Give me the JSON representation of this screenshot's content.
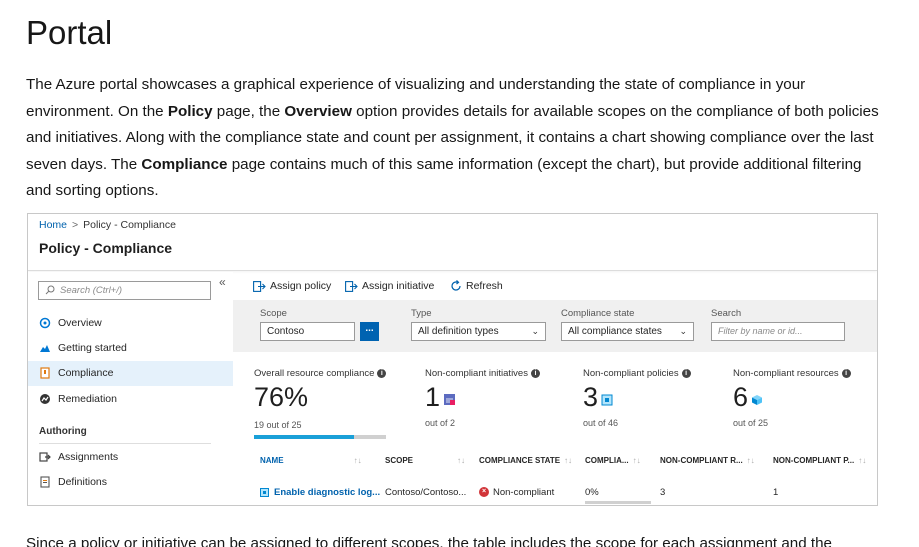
{
  "doc": {
    "title": "Portal",
    "intro_parts": [
      "The Azure portal showcases a graphical experience of visualizing and understanding the state of compliance in your environment. On the ",
      "Policy",
      " page, the ",
      "Overview",
      " option provides details for available scopes on the compliance of both policies and initiatives. Along with the compliance state and count per assignment, it contains a chart showing compliance over the last seven days. The ",
      "Compliance",
      " page contains much of this same information (except the chart), but provide additional filtering and sorting options."
    ],
    "bottom_text": "Since a policy or initiative can be assigned to different scopes, the table includes the scope for each assignment and the"
  },
  "screenshot": {
    "breadcrumb": {
      "home": "Home",
      "separator": ">",
      "current": "Policy - Compliance"
    },
    "blade_title": "Policy - Compliance",
    "collapse_glyph": "«",
    "nav": {
      "search_placeholder": "Search (Ctrl+/)",
      "items": [
        {
          "label": "Overview",
          "icon": "overview-icon"
        },
        {
          "label": "Getting started",
          "icon": "cloud-icon"
        },
        {
          "label": "Compliance",
          "icon": "compliance-icon",
          "active": true
        },
        {
          "label": "Remediation",
          "icon": "remediation-icon"
        }
      ],
      "group_label": "Authoring",
      "group_items": [
        {
          "label": "Assignments",
          "icon": "assignments-icon"
        },
        {
          "label": "Definitions",
          "icon": "definitions-icon"
        }
      ]
    },
    "toolbar": {
      "assign_policy": "Assign policy",
      "assign_initiative": "Assign initiative",
      "refresh": "Refresh"
    },
    "filters": {
      "scope_label": "Scope",
      "scope_value": "Contoso",
      "scope_button": "...",
      "type_label": "Type",
      "type_value": "All definition types",
      "state_label": "Compliance state",
      "state_value": "All compliance states",
      "search_label": "Search",
      "search_placeholder": "Filter by name or id..."
    },
    "kpis": {
      "overall": {
        "label": "Overall resource compliance",
        "value": "76%",
        "sub": "19 out of 25",
        "fraction": 0.76
      },
      "initiatives": {
        "label": "Non-compliant initiatives",
        "value": "1",
        "sub": "out of 2"
      },
      "policies": {
        "label": "Non-compliant policies",
        "value": "3",
        "sub": "out of 46"
      },
      "resources": {
        "label": "Non-compliant resources",
        "value": "6",
        "sub": "out of 25"
      }
    },
    "table": {
      "headers": [
        "NAME",
        "SCOPE",
        "COMPLIANCE STATE",
        "COMPLIA...",
        "NON-COMPLIANT R...",
        "NON-COMPLIANT P..."
      ],
      "sort_glyph": "↑↓",
      "row": {
        "name": "Enable diagnostic log...",
        "scope": "Contoso/Contoso...",
        "state": "Non-compliant",
        "compliance": "0%",
        "nc_resources": "3",
        "nc_policies": "1"
      }
    }
  }
}
